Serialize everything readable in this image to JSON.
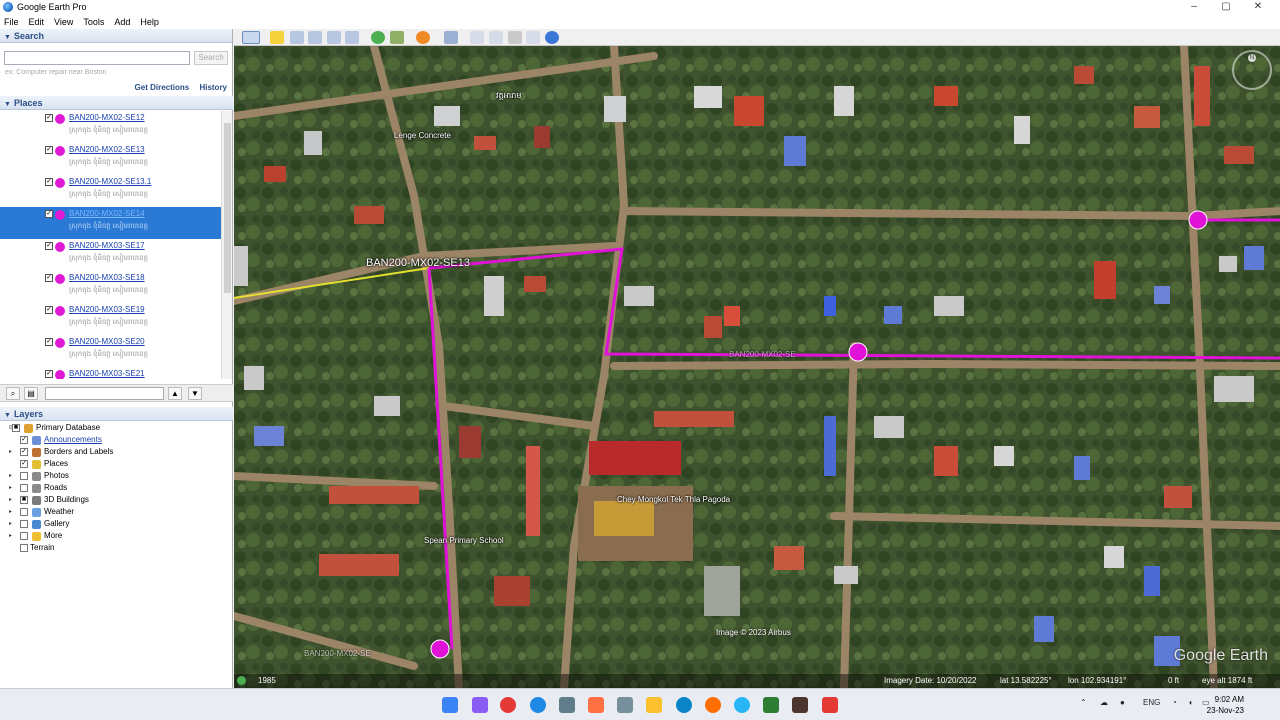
{
  "window": {
    "title": "Google Earth Pro",
    "controls": [
      "–",
      "▢",
      "✕"
    ]
  },
  "menu": [
    "File",
    "Edit",
    "View",
    "Tools",
    "Add",
    "Help"
  ],
  "search": {
    "header": "Search",
    "placeholder": "",
    "button": "Search",
    "hint": "ex: Computer repair near Boston",
    "get_directions": "Get Directions",
    "history": "History"
  },
  "places": {
    "header": "Places",
    "items": [
      {
        "name": "BAN200-MX02-SE12",
        "sub": "ស្រុកចុង ខុំមិនវ្យ សៀមរាបខេត្ត"
      },
      {
        "name": "BAN200-MX02-SE13",
        "sub": "ស្រុកចុង ខុំមិនវ្យ សៀមរាបខេត្ត"
      },
      {
        "name": "BAN200-MX02-SE13.1",
        "sub": "ស្រុកចុង ខុំមិនវ្យ សៀមរាបខេត្ត"
      },
      {
        "name": "BAN200-MX02-SE14",
        "sub": "ស្រុកចុង ខុំមិនវ្យ សៀមរាបខេត្ត",
        "selected": true
      },
      {
        "name": "BAN200-MX03-SE17",
        "sub": "ស្រុកចុង ខុំមិនវ្យ សៀមរាបខេត្ត"
      },
      {
        "name": "BAN200-MX03-SE18",
        "sub": "ស្រុកចុង ខុំមិនវ្យ សៀមរាបខេត្ត"
      },
      {
        "name": "BAN200-MX03-SE19",
        "sub": "ស្រុកចុង ខុំមិនវ្យ សៀមរាបខេត្ត"
      },
      {
        "name": "BAN200-MX03-SE20",
        "sub": "ស្រុកចុង ខុំមិនវ្យ សៀមរាបខេត្ត"
      },
      {
        "name": "BAN200-MX03-SE21",
        "sub": "ស្រុកចុង ខុំមិនវ្យ សៀមរាបខេត្ត"
      }
    ]
  },
  "layers": {
    "header": "Layers",
    "items": [
      {
        "label": "Primary Database",
        "checked": "partial"
      },
      {
        "label": "Announcements",
        "checked": true,
        "link": true
      },
      {
        "label": "Borders and Labels",
        "checked": true
      },
      {
        "label": "Places",
        "checked": true
      },
      {
        "label": "Photos",
        "checked": false
      },
      {
        "label": "Roads",
        "checked": false
      },
      {
        "label": "3D Buildings",
        "checked": "partial"
      },
      {
        "label": "Weather",
        "checked": false
      },
      {
        "label": "Gallery",
        "checked": false
      },
      {
        "label": "More",
        "checked": false
      },
      {
        "label": "Terrain",
        "checked": false
      }
    ]
  },
  "map": {
    "labels": {
      "route": "BAN200-MX02-SE13",
      "pagoda": "Chey Mongkol Tek Thla Pagoda",
      "school": "Spean Primary School",
      "concrete": "Lenge Concrete",
      "temple_top": "វត្តអារាម",
      "road_lower": "BAN200-MX02-SE",
      "road_mid": "BAN200-MX02-SE"
    },
    "copyright": "Image © 2023 Airbus",
    "watermark": "Google Earth",
    "colors": {
      "route": "#e012d8",
      "boundary": "#e3e030"
    }
  },
  "status": {
    "year": "1985",
    "imagery_date": "Imagery Date: 10/20/2022",
    "lat": "lat   13.582225°",
    "lon": "lon  102.934191°",
    "elev": "0 ft",
    "eye_alt": "eye alt   1874 ft"
  },
  "taskbar": {
    "lang": "ENG",
    "time": "9:02 AM",
    "date": "23-Nov-23"
  }
}
